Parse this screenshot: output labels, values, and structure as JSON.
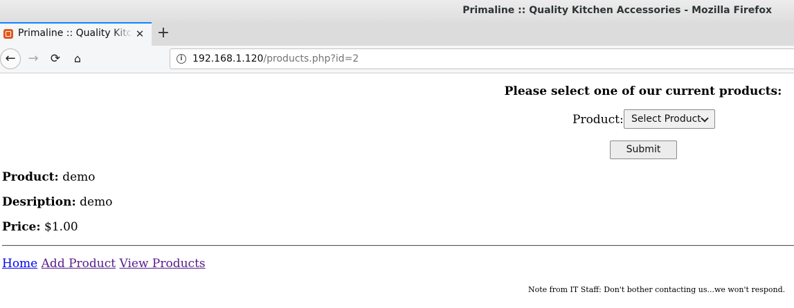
{
  "window": {
    "title": "Primaline :: Quality Kitchen Accessories - Mozilla Firefox"
  },
  "tab": {
    "label": "Primaline :: Quality Kitchen Accessories",
    "close_glyph": "✕",
    "newtab_glyph": "+",
    "favicon": "xampp-favicon-icon"
  },
  "nav": {
    "back_glyph": "←",
    "forward_glyph": "→",
    "reload_glyph": "⟳",
    "home_glyph": "⌂",
    "url_host": "192.168.1.120",
    "url_path": "/products.php?id=2"
  },
  "page": {
    "select_heading": "Please select one of our current products:",
    "product_label": "Product:",
    "product_select_value": "Select Product",
    "submit_label": "Submit",
    "details": [
      {
        "label": "Product:",
        "value": "demo"
      },
      {
        "label": "Desription:",
        "value": "demo"
      },
      {
        "label": "Price:",
        "value": "$1.00"
      }
    ],
    "links": [
      {
        "label": "Home"
      },
      {
        "label": "Add Product"
      },
      {
        "label": "View Products"
      }
    ],
    "note": "Note from IT Staff: Don't bother contacting us...we won't respond."
  },
  "colors": {
    "tab_accent": "#0a84ff",
    "link_unvisited": "#0000ee",
    "link_visited": "#551a8b"
  }
}
